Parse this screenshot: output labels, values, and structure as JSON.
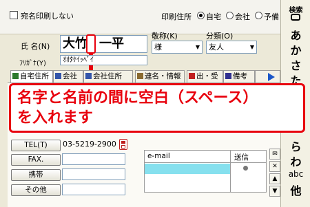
{
  "top": {
    "no_print_label": "宛名印刷しない",
    "print_address_label": "印刷住所",
    "options": [
      "自宅",
      "会社",
      "予備"
    ],
    "selected_option": "自宅"
  },
  "name": {
    "label": "氏  名(N)",
    "value_family": "大竹",
    "value_given": "一平",
    "furigana_label": "ﾌﾘｶﾞﾅ(Y)",
    "furigana_value": "ｵｵﾀｹｲｯﾍﾟｲ"
  },
  "honorific": {
    "label": "敬称(K)",
    "value": "様"
  },
  "category": {
    "label": "分類(O)",
    "value": "友人"
  },
  "tabs": [
    {
      "label": "自宅住所",
      "color": "#2d7a2d"
    },
    {
      "label": "会社",
      "color": "#3355aa"
    },
    {
      "label": "会社住所",
      "color": "#3355aa"
    },
    {
      "label": "連名・情報",
      "color": "#8a6a30"
    },
    {
      "label": "出・受",
      "color": "#c02020"
    },
    {
      "label": "備考",
      "color": "#303090"
    },
    {
      "label": "",
      "color": "#1a56c8"
    }
  ],
  "overlay": {
    "line1": "名字と名前の間に空白（スペース）",
    "line2": "を入れます",
    "color": "#e8000d"
  },
  "contacts": {
    "tel_label": "TEL(T)",
    "tel_value": "03-5219-2900",
    "fax_label": "FAX.",
    "mobile_label": "携帯",
    "other_label": "その他"
  },
  "email_grid": {
    "col_email": "e-mail",
    "col_send": "送信"
  },
  "sidebar": {
    "search_label": "検索",
    "items": [
      "あ",
      "か",
      "さ",
      "た",
      "ら",
      "わ",
      "abc",
      "他"
    ]
  }
}
